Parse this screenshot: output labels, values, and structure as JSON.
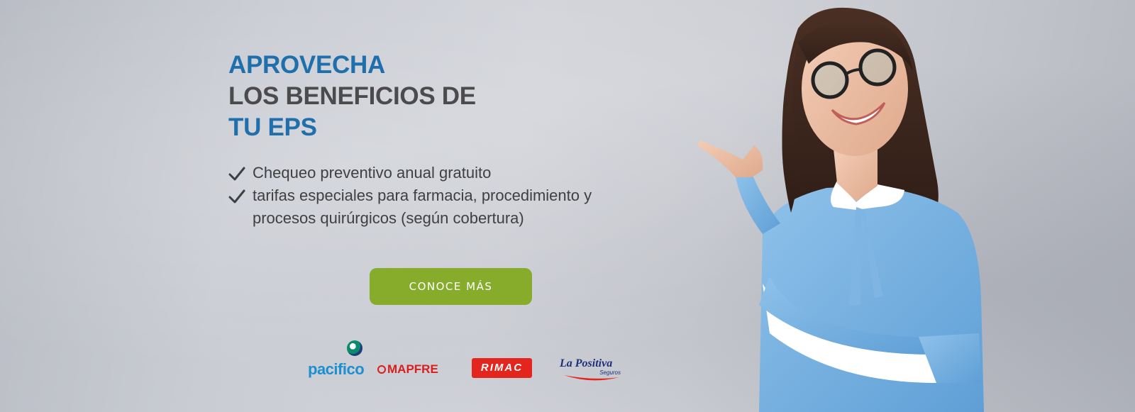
{
  "hero": {
    "headline": {
      "line1": "APROVECHA",
      "line2": "LOS BENEFICIOS DE",
      "line3": "TU EPS"
    },
    "benefits": [
      "Chequeo preventivo anual gratuito",
      "tarifas especiales para farmacia, procedimiento y procesos quirúrgicos (según cobertura)"
    ],
    "cta_label": "CONOCE MÁS"
  },
  "partners": {
    "pacifico": "pacifico",
    "mapfre": "MAPFRE",
    "rimac": "RIMAC",
    "la_positiva": "La Positiva",
    "la_positiva_sub": "Seguros"
  },
  "icons": {
    "benefit_bullet": "check-icon"
  },
  "colors": {
    "headline_blue": "#1f6fad",
    "headline_dark": "#4b4b4d",
    "cta_green": "#87ac2c",
    "pacifico_blue": "#1c8fcf",
    "mapfre_red": "#d81e1e",
    "rimac_red": "#e3251d",
    "positiva_navy": "#1d2f7a"
  }
}
